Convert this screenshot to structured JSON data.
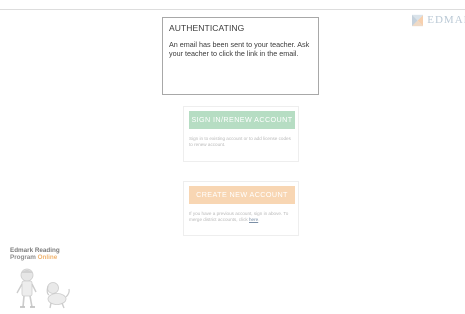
{
  "brand": {
    "name": "EDMAR"
  },
  "auth": {
    "title": "AUTHENTICATING",
    "message": "An email has been sent to your teacher. Ask your teacher to click the link in the email."
  },
  "signin": {
    "button_label": "SIGN IN/RENEW ACCOUNT",
    "note": "Sign in to existing account or to add license codes to renew account."
  },
  "create": {
    "button_label": "CREATE NEW ACCOUNT",
    "note_prefix": "If you have a previous account, sign in above. To merge district accounts, click ",
    "note_link": "here",
    "note_suffix": "."
  },
  "program": {
    "line1": "Edmark Reading",
    "line2_prefix": "Program ",
    "line2_highlight": "Online"
  },
  "colors": {
    "signin_button": "#b6ddc3",
    "create_button": "#f8d6b3",
    "brand_text": "#8aa3b8",
    "online_text": "#f0b36e"
  }
}
